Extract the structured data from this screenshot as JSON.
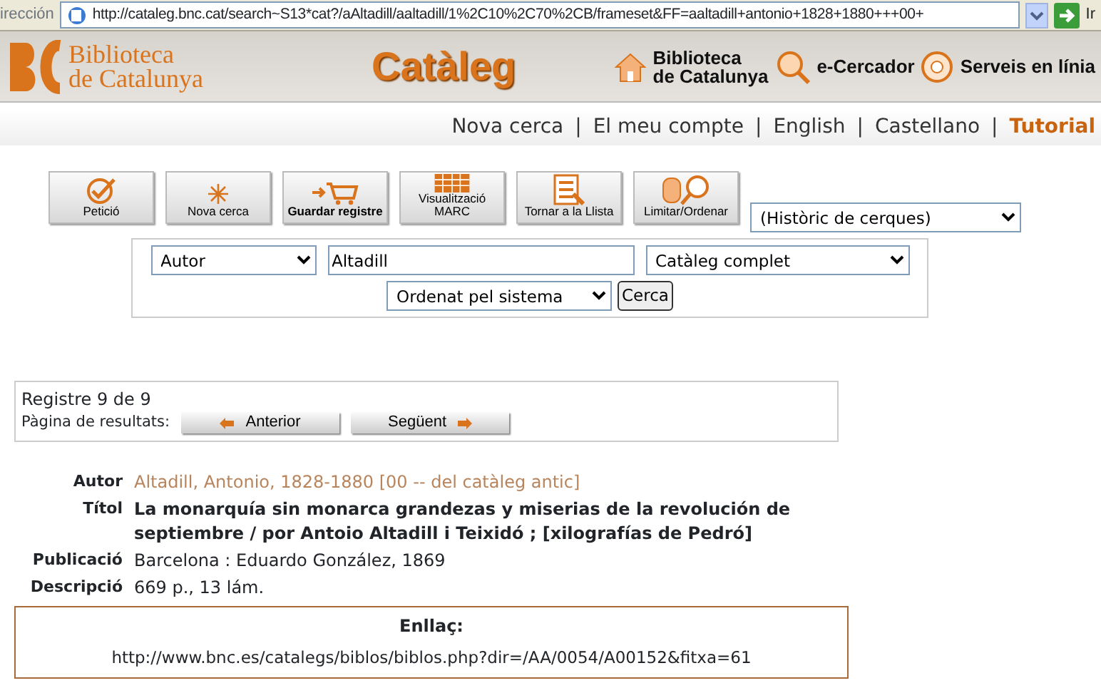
{
  "browser": {
    "address_label": "irección",
    "url": "http://cataleg.bnc.cat/search~S13*cat?/aAltadill/aaltadill/1%2C10%2C70%2CB/frameset&FF=aaltadill+antonio+1828+1880+++00+",
    "go_label": "Ir"
  },
  "header": {
    "logo_lines": [
      "Biblioteca",
      "de Catalunya"
    ],
    "title": "Catàleg",
    "links": [
      {
        "lines": [
          "Biblioteca",
          "de Catalunya"
        ],
        "kind": "house"
      },
      {
        "lines": [
          "e-Cercador"
        ],
        "kind": "magnifier"
      },
      {
        "lines": [
          "Serveis en línia"
        ],
        "kind": "lifebuoy"
      }
    ]
  },
  "nav": {
    "separator": "|",
    "items": [
      {
        "label": "Nova cerca",
        "highlighted": false
      },
      {
        "label": "El meu compte",
        "highlighted": false
      },
      {
        "label": "English",
        "highlighted": false
      },
      {
        "label": "Castellano",
        "highlighted": false
      },
      {
        "label": "Tutorial",
        "highlighted": true
      }
    ]
  },
  "toolbar": {
    "buttons": [
      {
        "lines": [
          "Petició"
        ],
        "kind": "check",
        "bold": false
      },
      {
        "lines": [
          "Nova cerca"
        ],
        "kind": "spark",
        "bold": false
      },
      {
        "lines": [
          "Guardar registre"
        ],
        "kind": "cart",
        "bold": true
      },
      {
        "lines": [
          "Visualització",
          "MARC"
        ],
        "kind": "grid",
        "bold": false
      },
      {
        "lines": [
          "Tornar a la Llista"
        ],
        "kind": "list",
        "bold": false
      },
      {
        "lines": [
          "Limitar/Ordenar"
        ],
        "kind": "hand",
        "bold": false
      }
    ],
    "history_select": "(Històric de cerques)"
  },
  "search": {
    "field_select": "Autor",
    "query": "Altadill",
    "scope_select": "Catàleg complet",
    "sort_select": "Ordenat pel sistema",
    "submit": "Cerca"
  },
  "results": {
    "count": "Registre 9 de 9",
    "pager_label": "Pàgina de resultats:",
    "prev": "Anterior",
    "next": "Següent"
  },
  "record": [
    {
      "label": "Autor",
      "value": "Altadill, Antonio, 1828-1880 [00 -- del catàleg antic]",
      "kind": "link"
    },
    {
      "label": "Títol",
      "value": "La monarquía sin monarca grandezas y miserias de la revolución de septiembre / por Antoio Altadill i Teixidó ; [xilografías de Pedró]",
      "kind": "title"
    },
    {
      "label": "Publicació",
      "value": "Barcelona : Eduardo González, 1869",
      "kind": "text"
    },
    {
      "label": "Descripció",
      "value": "669 p., 13 lám.",
      "kind": "text"
    }
  ],
  "link_box": {
    "heading": "Enllaç:",
    "url": "http://www.bnc.es/catalegs/biblos/biblos.php?dir=/AA/0054/A00152&fitxa=61"
  }
}
